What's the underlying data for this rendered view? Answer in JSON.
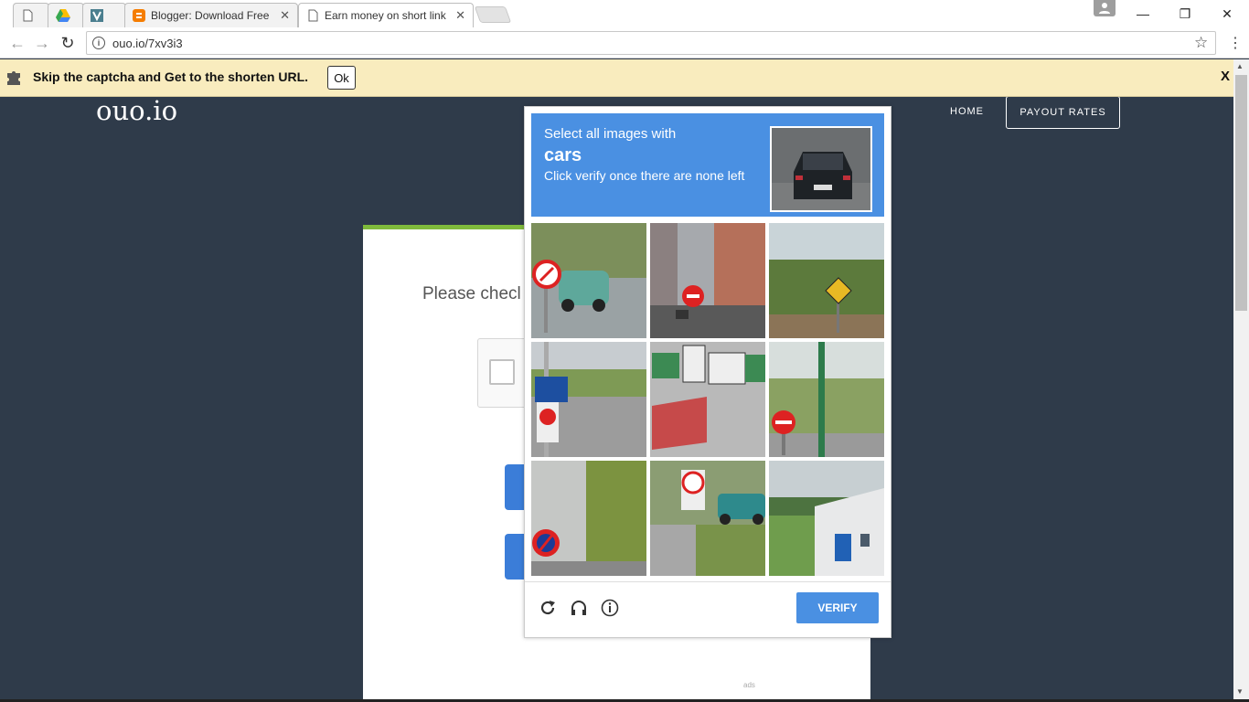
{
  "browser": {
    "tabs": [
      {
        "label": "",
        "icon": "blank-page-icon"
      },
      {
        "label": "",
        "icon": "google-drive-icon"
      },
      {
        "label": "",
        "icon": "vt-icon"
      },
      {
        "label": "Blogger: Download Free",
        "icon": "blogger-icon",
        "close": "✕"
      },
      {
        "label": "Earn money on short link",
        "icon": "blank-page-icon",
        "close": "✕",
        "active": true
      }
    ],
    "window_buttons": {
      "minimize": "—",
      "restore": "❐",
      "close": "✕"
    },
    "url": "ouo.io/7xv3i3",
    "star": "☆",
    "menu": "⋮",
    "back": "←",
    "forward": "→",
    "reload": "↻"
  },
  "notification": {
    "text": "Skip the captcha and Get to the shorten URL.",
    "ok_label": "Ok",
    "close_label": "X"
  },
  "site": {
    "logo": "ouo.io",
    "nav_home": "HOME",
    "nav_payout": "PAYOUT RATES",
    "card_text": "Please checl",
    "ads_label": "ads"
  },
  "captcha": {
    "line1": "Select all images with",
    "keyword": "cars",
    "line3": "Click verify once there are none left",
    "verify_label": "VERIFY",
    "colors": {
      "accent": "#4a90e2"
    }
  }
}
